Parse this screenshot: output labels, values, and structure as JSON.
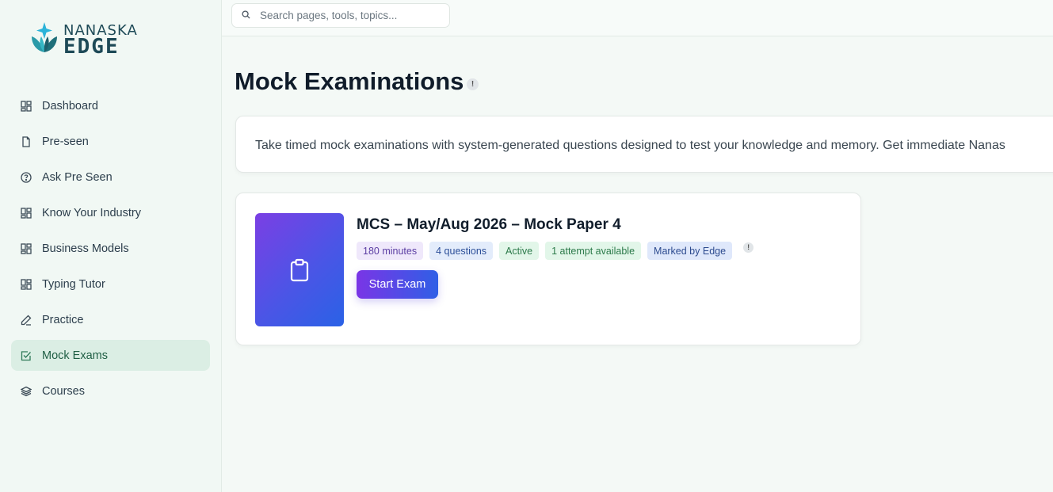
{
  "brand": {
    "top": "NANASKA",
    "bottom": "EDGE"
  },
  "search": {
    "placeholder": "Search pages, tools, topics..."
  },
  "sidebar": {
    "items": [
      {
        "label": "Dashboard",
        "icon": "layout-grid-icon"
      },
      {
        "label": "Pre-seen",
        "icon": "file-icon"
      },
      {
        "label": "Ask Pre Seen",
        "icon": "help-circle-icon"
      },
      {
        "label": "Know Your Industry",
        "icon": "layout-grid-icon"
      },
      {
        "label": "Business Models",
        "icon": "layout-grid-icon"
      },
      {
        "label": "Typing Tutor",
        "icon": "layout-grid-icon"
      },
      {
        "label": "Practice",
        "icon": "pencil-icon"
      },
      {
        "label": "Mock Exams",
        "icon": "check-square-icon",
        "active": true
      },
      {
        "label": "Courses",
        "icon": "layers-icon"
      }
    ]
  },
  "page": {
    "title": "Mock Examinations",
    "info": "!",
    "description": "Take timed mock examinations with system-generated questions designed to test your knowledge and memory. Get immediate Nanas"
  },
  "exam": {
    "title": "MCS – May/Aug 2026 – Mock Paper 4",
    "tags": {
      "duration": "180 minutes",
      "questions": "4 questions",
      "status": "Active",
      "attempts": "1 attempt available",
      "marking": "Marked by Edge"
    },
    "info": "!",
    "start_label": "Start Exam"
  },
  "colors": {
    "accent_start": "#7a35e6",
    "accent_end": "#2f5fe6",
    "sidebar_active_bg": "#dbeee4",
    "brand": "#1e4a57"
  }
}
